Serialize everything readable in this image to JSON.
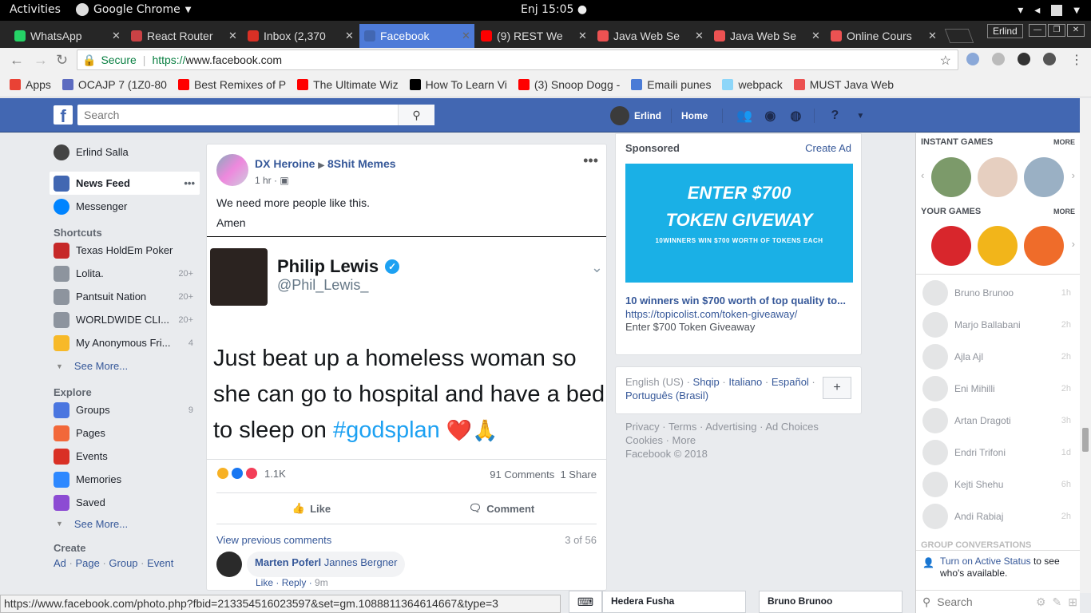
{
  "system_bar": {
    "activities": "Activities",
    "app_name": "Google Chrome",
    "clock": "Enj 15:05 ●"
  },
  "tabs": [
    {
      "title": "WhatsApp",
      "icon": "whatsapp-icon",
      "color": "#25d366"
    },
    {
      "title": "React Router",
      "icon": "react-router-icon",
      "color": "#ca4245"
    },
    {
      "title": "Inbox (2,370",
      "icon": "gmail-icon",
      "color": "#d93025"
    },
    {
      "title": "Facebook",
      "icon": "facebook-icon",
      "color": "#4267b2"
    },
    {
      "title": "(9) REST We",
      "icon": "youtube-icon",
      "color": "#ff0000"
    },
    {
      "title": "Java Web Se",
      "icon": "udemy-icon",
      "color": "#ec5252"
    },
    {
      "title": "Java Web Se",
      "icon": "udemy-icon",
      "color": "#ec5252"
    },
    {
      "title": "Online Cours",
      "icon": "udemy-icon",
      "color": "#ec5252"
    }
  ],
  "window": {
    "user": "Erlind"
  },
  "address_bar": {
    "secure_label": "Secure",
    "scheme": "https://",
    "host": "www.facebook.com"
  },
  "bookmarks": [
    {
      "label": "Apps",
      "icon": "apps-icon",
      "color": "#e94235"
    },
    {
      "label": "OCAJP 7 (1Z0-80",
      "icon": "java-icon",
      "color": "#5c6bc0"
    },
    {
      "label": "Best Remixes of P",
      "icon": "youtube-icon",
      "color": "#ff0000"
    },
    {
      "label": "The Ultimate Wiz",
      "icon": "youtube-icon",
      "color": "#ff0000"
    },
    {
      "label": "How To Learn Vi",
      "icon": "medium-icon",
      "color": "#000000"
    },
    {
      "label": "(3) Snoop Dogg -",
      "icon": "youtube-icon",
      "color": "#ff0000"
    },
    {
      "label": "Emaili punes",
      "icon": "mail-icon",
      "color": "#4a7bd6"
    },
    {
      "label": "webpack",
      "icon": "webpack-icon",
      "color": "#8dd6f9"
    },
    {
      "label": "MUST Java Web",
      "icon": "udemy-icon",
      "color": "#ec5252"
    }
  ],
  "fb_header": {
    "search_placeholder": "Search",
    "user": "Erlind",
    "home": "Home"
  },
  "left_nav": {
    "profile": "Erlind Salla",
    "main": [
      {
        "label": "News Feed",
        "icon": "news-feed-icon",
        "color": "#4267b2"
      },
      {
        "label": "Messenger",
        "icon": "messenger-icon",
        "color": "#0084ff"
      }
    ],
    "shortcuts_title": "Shortcuts",
    "shortcuts": [
      {
        "label": "Texas HoldEm Poker",
        "count": "",
        "color": "#c62828"
      },
      {
        "label": "Lolita.",
        "count": "20+",
        "color": "#8d949e"
      },
      {
        "label": "Pantsuit Nation",
        "count": "20+",
        "color": "#8d949e"
      },
      {
        "label": "WORLDWIDE CLI...",
        "count": "20+",
        "color": "#8d949e"
      },
      {
        "label": "My Anonymous Fri...",
        "count": "4",
        "color": "#f7b928"
      }
    ],
    "see_more": "See More...",
    "explore_title": "Explore",
    "explore": [
      {
        "label": "Groups",
        "count": "9",
        "color": "#4a76e0"
      },
      {
        "label": "Pages",
        "count": "",
        "color": "#f2683a"
      },
      {
        "label": "Events",
        "count": "",
        "color": "#d93025"
      },
      {
        "label": "Memories",
        "count": "",
        "color": "#2d88ff"
      },
      {
        "label": "Saved",
        "count": "",
        "color": "#8c4bd3"
      }
    ],
    "create_title": "Create",
    "create_links": [
      "Ad",
      "Page",
      "Group",
      "Event"
    ]
  },
  "post": {
    "author": "DX Heroine",
    "group": "8Shit Memes",
    "time": "1 hr ·",
    "text": "We need more people like this.",
    "text2": "Amen",
    "tweet": {
      "name": "Philip Lewis",
      "handle": "@Phil_Lewis_",
      "text": "Just beat up a homeless woman so she can go to hospital and have a bed to sleep on ",
      "hashtag": "#godsplan",
      "emoji": "❤️🙏"
    },
    "reactions_count": "1.1K",
    "comments": "91 Comments",
    "shares": "1 Share",
    "like": "Like",
    "comment": "Comment",
    "view_previous": "View previous comments",
    "pagination": "3 of 56",
    "comment_author": "Marten Poferl",
    "comment_tag": "Jannes Bergner",
    "comment_like": "Like",
    "comment_reply": "Reply",
    "comment_time": "9m"
  },
  "sponsored": {
    "title": "Sponsored",
    "create_ad": "Create Ad",
    "ad_line1": "ENTER $700",
    "ad_line2": "TOKEN GIVEWAY",
    "ad_line3": "10WINNERS WIN $700 WORTH OF TOKENS EACH",
    "headline": "10 winners win $700 worth of top quality to...",
    "url": "https://topicolist.com/token-giveaway/",
    "desc": "Enter $700 Token Giveaway"
  },
  "languages": {
    "current": "English (US)",
    "others": [
      "Shqip",
      "Italiano",
      "Español",
      "Português (Brasil)"
    ]
  },
  "footer": {
    "links": [
      "Privacy",
      "Terms",
      "Advertising",
      "Ad Choices",
      "Cookies",
      "More"
    ],
    "copyright": "Facebook © 2018"
  },
  "right_col": {
    "instant_games": "INSTANT GAMES",
    "your_games": "YOUR GAMES",
    "more": "MORE",
    "friends": [
      {
        "name": "Bruno Brunoo",
        "time": "1h"
      },
      {
        "name": "Marjo Ballabani",
        "time": "2h"
      },
      {
        "name": "Ajla Ajl",
        "time": "2h"
      },
      {
        "name": "Eni Mihilli",
        "time": "2h"
      },
      {
        "name": "Artan Dragoti",
        "time": "3h"
      },
      {
        "name": "Endri Trifoni",
        "time": "1d"
      },
      {
        "name": "Kejti Shehu",
        "time": "6h"
      },
      {
        "name": "Andi Rabiaj",
        "time": "2h"
      }
    ],
    "group_conv": "GROUP CONVERSATIONS",
    "active_link": "Turn on Active Status",
    "active_rest": " to see who's available.",
    "search": "Search"
  },
  "status_url": "https://www.facebook.com/photo.php?fbid=213354516023597&set=gm.1088811364614667&type=3",
  "chat_tabs": [
    "Hedera Fusha",
    "Bruno Brunoo"
  ]
}
